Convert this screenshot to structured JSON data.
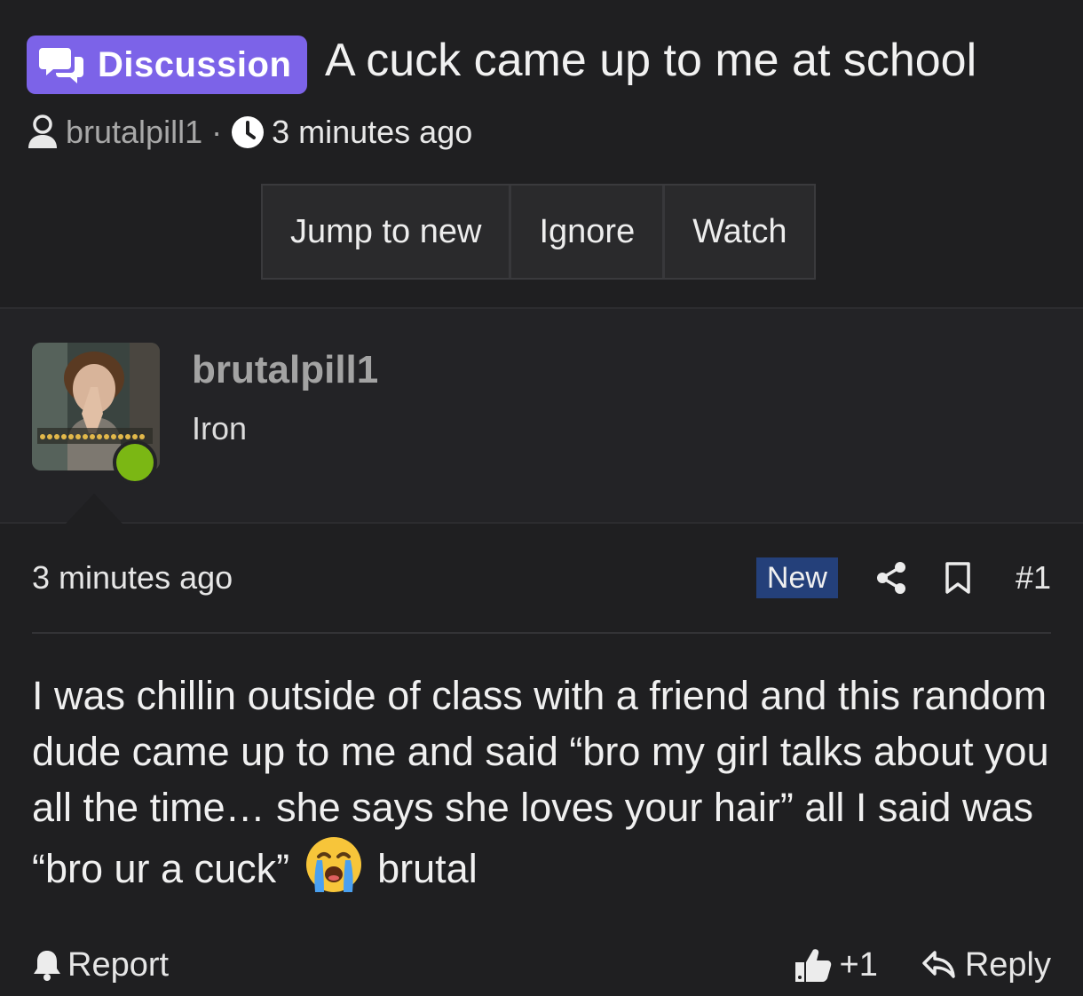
{
  "thread": {
    "prefix": "Discussion",
    "title": "A cuck came up to me at school",
    "author": "brutalpill1",
    "separator": "·",
    "time": "3 minutes ago",
    "buttons": [
      "Jump to new",
      "Ignore",
      "Watch"
    ]
  },
  "post": {
    "author": "brutalpill1",
    "user_title": "Iron",
    "time": "3 minutes ago",
    "badge": "New",
    "number": "#1",
    "body_part1": "I was chillin outside of class with a friend and this random dude came up to me and said “bro my girl talks about you all the time… she says she loves your hair” all I said was “bro ur a cuck”",
    "body_part2": "brutal",
    "emoji": "loudly-crying-face",
    "online": true
  },
  "footer": {
    "report": "Report",
    "like_count": "+1",
    "reply": "Reply"
  },
  "colors": {
    "background": "#1f1f21",
    "badge": "#7c63e8",
    "new_badge": "#24407a",
    "online": "#7bb714"
  }
}
